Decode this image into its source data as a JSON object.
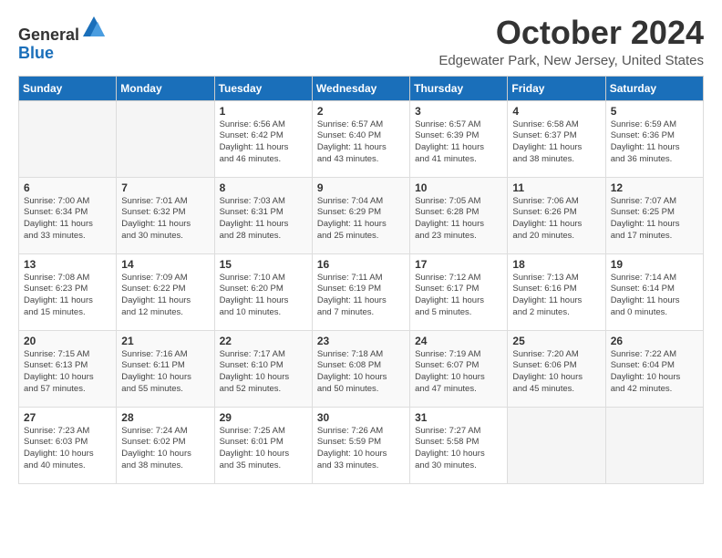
{
  "header": {
    "logo_general": "General",
    "logo_blue": "Blue",
    "month": "October 2024",
    "location": "Edgewater Park, New Jersey, United States"
  },
  "weekdays": [
    "Sunday",
    "Monday",
    "Tuesday",
    "Wednesday",
    "Thursday",
    "Friday",
    "Saturday"
  ],
  "weeks": [
    [
      {
        "day": "",
        "empty": true
      },
      {
        "day": "",
        "empty": true
      },
      {
        "day": "1",
        "detail": "Sunrise: 6:56 AM\nSunset: 6:42 PM\nDaylight: 11 hours\nand 46 minutes."
      },
      {
        "day": "2",
        "detail": "Sunrise: 6:57 AM\nSunset: 6:40 PM\nDaylight: 11 hours\nand 43 minutes."
      },
      {
        "day": "3",
        "detail": "Sunrise: 6:57 AM\nSunset: 6:39 PM\nDaylight: 11 hours\nand 41 minutes."
      },
      {
        "day": "4",
        "detail": "Sunrise: 6:58 AM\nSunset: 6:37 PM\nDaylight: 11 hours\nand 38 minutes."
      },
      {
        "day": "5",
        "detail": "Sunrise: 6:59 AM\nSunset: 6:36 PM\nDaylight: 11 hours\nand 36 minutes."
      }
    ],
    [
      {
        "day": "6",
        "detail": "Sunrise: 7:00 AM\nSunset: 6:34 PM\nDaylight: 11 hours\nand 33 minutes."
      },
      {
        "day": "7",
        "detail": "Sunrise: 7:01 AM\nSunset: 6:32 PM\nDaylight: 11 hours\nand 30 minutes."
      },
      {
        "day": "8",
        "detail": "Sunrise: 7:03 AM\nSunset: 6:31 PM\nDaylight: 11 hours\nand 28 minutes."
      },
      {
        "day": "9",
        "detail": "Sunrise: 7:04 AM\nSunset: 6:29 PM\nDaylight: 11 hours\nand 25 minutes."
      },
      {
        "day": "10",
        "detail": "Sunrise: 7:05 AM\nSunset: 6:28 PM\nDaylight: 11 hours\nand 23 minutes."
      },
      {
        "day": "11",
        "detail": "Sunrise: 7:06 AM\nSunset: 6:26 PM\nDaylight: 11 hours\nand 20 minutes."
      },
      {
        "day": "12",
        "detail": "Sunrise: 7:07 AM\nSunset: 6:25 PM\nDaylight: 11 hours\nand 17 minutes."
      }
    ],
    [
      {
        "day": "13",
        "detail": "Sunrise: 7:08 AM\nSunset: 6:23 PM\nDaylight: 11 hours\nand 15 minutes."
      },
      {
        "day": "14",
        "detail": "Sunrise: 7:09 AM\nSunset: 6:22 PM\nDaylight: 11 hours\nand 12 minutes."
      },
      {
        "day": "15",
        "detail": "Sunrise: 7:10 AM\nSunset: 6:20 PM\nDaylight: 11 hours\nand 10 minutes."
      },
      {
        "day": "16",
        "detail": "Sunrise: 7:11 AM\nSunset: 6:19 PM\nDaylight: 11 hours\nand 7 minutes."
      },
      {
        "day": "17",
        "detail": "Sunrise: 7:12 AM\nSunset: 6:17 PM\nDaylight: 11 hours\nand 5 minutes."
      },
      {
        "day": "18",
        "detail": "Sunrise: 7:13 AM\nSunset: 6:16 PM\nDaylight: 11 hours\nand 2 minutes."
      },
      {
        "day": "19",
        "detail": "Sunrise: 7:14 AM\nSunset: 6:14 PM\nDaylight: 11 hours\nand 0 minutes."
      }
    ],
    [
      {
        "day": "20",
        "detail": "Sunrise: 7:15 AM\nSunset: 6:13 PM\nDaylight: 10 hours\nand 57 minutes."
      },
      {
        "day": "21",
        "detail": "Sunrise: 7:16 AM\nSunset: 6:11 PM\nDaylight: 10 hours\nand 55 minutes."
      },
      {
        "day": "22",
        "detail": "Sunrise: 7:17 AM\nSunset: 6:10 PM\nDaylight: 10 hours\nand 52 minutes."
      },
      {
        "day": "23",
        "detail": "Sunrise: 7:18 AM\nSunset: 6:08 PM\nDaylight: 10 hours\nand 50 minutes."
      },
      {
        "day": "24",
        "detail": "Sunrise: 7:19 AM\nSunset: 6:07 PM\nDaylight: 10 hours\nand 47 minutes."
      },
      {
        "day": "25",
        "detail": "Sunrise: 7:20 AM\nSunset: 6:06 PM\nDaylight: 10 hours\nand 45 minutes."
      },
      {
        "day": "26",
        "detail": "Sunrise: 7:22 AM\nSunset: 6:04 PM\nDaylight: 10 hours\nand 42 minutes."
      }
    ],
    [
      {
        "day": "27",
        "detail": "Sunrise: 7:23 AM\nSunset: 6:03 PM\nDaylight: 10 hours\nand 40 minutes."
      },
      {
        "day": "28",
        "detail": "Sunrise: 7:24 AM\nSunset: 6:02 PM\nDaylight: 10 hours\nand 38 minutes."
      },
      {
        "day": "29",
        "detail": "Sunrise: 7:25 AM\nSunset: 6:01 PM\nDaylight: 10 hours\nand 35 minutes."
      },
      {
        "day": "30",
        "detail": "Sunrise: 7:26 AM\nSunset: 5:59 PM\nDaylight: 10 hours\nand 33 minutes."
      },
      {
        "day": "31",
        "detail": "Sunrise: 7:27 AM\nSunset: 5:58 PM\nDaylight: 10 hours\nand 30 minutes."
      },
      {
        "day": "",
        "empty": true
      },
      {
        "day": "",
        "empty": true
      }
    ]
  ]
}
